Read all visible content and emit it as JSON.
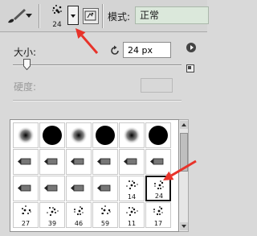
{
  "toolbar": {
    "tool_icon": "brush-icon",
    "brush_size": "24",
    "picker_icon": "chevron-down-icon",
    "panel_icon": "brush-panel-icon",
    "mode_label": "模式:",
    "mode_value": "正常"
  },
  "picker": {
    "size_label": "大小:",
    "size_value": "24 px",
    "reset_icon": "reset-size-icon",
    "menu_icon": "flyout-menu-icon",
    "new_preset_icon": "new-preset-icon",
    "hardness_label": "硬度:",
    "size_slider_percent": 8,
    "hardness_value": ""
  },
  "presets": [
    {
      "kind": "round-soft",
      "label": ""
    },
    {
      "kind": "round-hard",
      "label": ""
    },
    {
      "kind": "round-soft",
      "label": ""
    },
    {
      "kind": "round-hard",
      "label": ""
    },
    {
      "kind": "round-soft",
      "label": ""
    },
    {
      "kind": "round-hard",
      "label": ""
    },
    {
      "kind": "tool-tip",
      "label": ""
    },
    {
      "kind": "tool-tip",
      "label": ""
    },
    {
      "kind": "tool-tip",
      "label": ""
    },
    {
      "kind": "tool-tip",
      "label": ""
    },
    {
      "kind": "tool-tip",
      "label": ""
    },
    {
      "kind": "tool-tip",
      "label": ""
    },
    {
      "kind": "tool-tip",
      "label": ""
    },
    {
      "kind": "tool-tip",
      "label": ""
    },
    {
      "kind": "tool-tip",
      "label": ""
    },
    {
      "kind": "tool-tip",
      "label": ""
    },
    {
      "kind": "scatter",
      "label": "14"
    },
    {
      "kind": "scatter",
      "label": "24",
      "selected": true
    },
    {
      "kind": "scatter",
      "label": "27"
    },
    {
      "kind": "scatter",
      "label": "39"
    },
    {
      "kind": "scatter",
      "label": "46"
    },
    {
      "kind": "scatter",
      "label": "59"
    },
    {
      "kind": "scatter",
      "label": "11"
    },
    {
      "kind": "scatter",
      "label": "17"
    }
  ],
  "annotation_color": "#e8332a"
}
